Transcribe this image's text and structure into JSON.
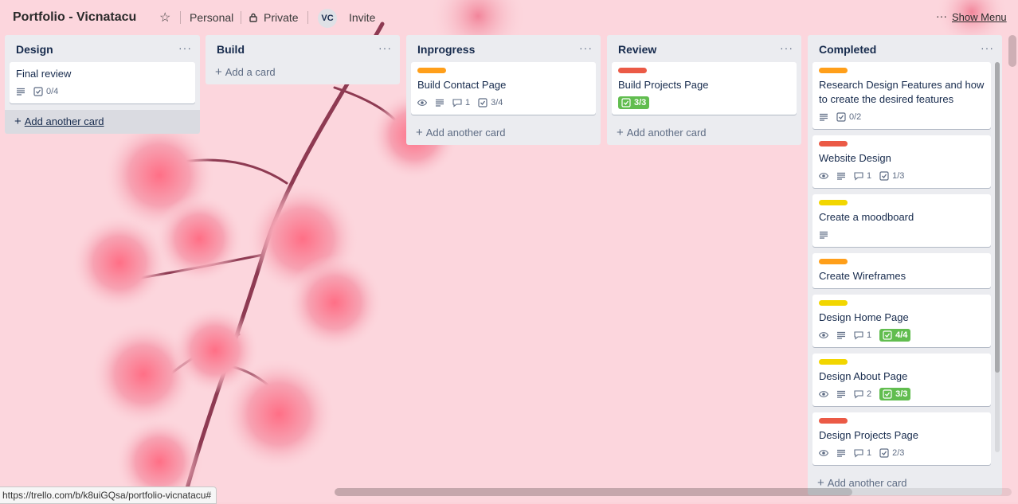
{
  "header": {
    "board_title": "Portfolio - Vicnatacu",
    "visibility_team": "Personal",
    "visibility_privacy": "Private",
    "avatar_initials": "VC",
    "invite_label": "Invite",
    "show_menu_label": "Show Menu",
    "icons": {
      "star": "star-icon",
      "lock": "lock-icon",
      "menu": "more-icon"
    }
  },
  "lists": [
    {
      "title": "Design",
      "cards": [
        {
          "title": "Final review",
          "label_color": null,
          "description": true,
          "checklist": "0/4"
        }
      ],
      "add_label": "Add another card"
    },
    {
      "title": "Build",
      "cards": [],
      "add_label": "Add a card"
    },
    {
      "title": "Inprogress",
      "cards": [
        {
          "title": "Build Contact Page",
          "label_color": "#ff9f1a",
          "watch": true,
          "description": true,
          "comments": "1",
          "checklist": "3/4"
        }
      ],
      "add_label": "Add another card"
    },
    {
      "title": "Review",
      "cards": [
        {
          "title": "Build Projects Page",
          "label_color": "#eb5a46",
          "checklist_complete": "3/3"
        }
      ],
      "add_label": "Add another card"
    },
    {
      "title": "Completed",
      "cards": [
        {
          "title": "Research Design Features and how to create the desired features",
          "label_color": "#ff9f1a",
          "description": true,
          "checklist": "0/2"
        },
        {
          "title": "Website Design",
          "label_color": "#eb5a46",
          "watch": true,
          "description": true,
          "comments": "1",
          "checklist": "1/3"
        },
        {
          "title": "Create a moodboard",
          "label_color": "#f2d600",
          "description": true
        },
        {
          "title": "Create Wireframes",
          "label_color": "#ff9f1a"
        },
        {
          "title": "Design Home Page",
          "label_color": "#f2d600",
          "watch": true,
          "description": true,
          "comments": "1",
          "checklist_complete": "4/4"
        },
        {
          "title": "Design About Page",
          "label_color": "#f2d600",
          "watch": true,
          "description": true,
          "comments": "2",
          "checklist_complete": "3/3"
        },
        {
          "title": "Design Projects Page",
          "label_color": "#eb5a46",
          "watch": true,
          "description": true,
          "comments": "1",
          "checklist": "2/3"
        }
      ],
      "add_label": "Add another card"
    }
  ],
  "status_bar": {
    "url": "https://trello.com/b/k8uiGQsa/portfolio-vicnatacu#"
  },
  "colors": {
    "green_badge": "#61bd4f",
    "list_bg": "#ebecf0",
    "board_bg": "#fbd3da"
  }
}
